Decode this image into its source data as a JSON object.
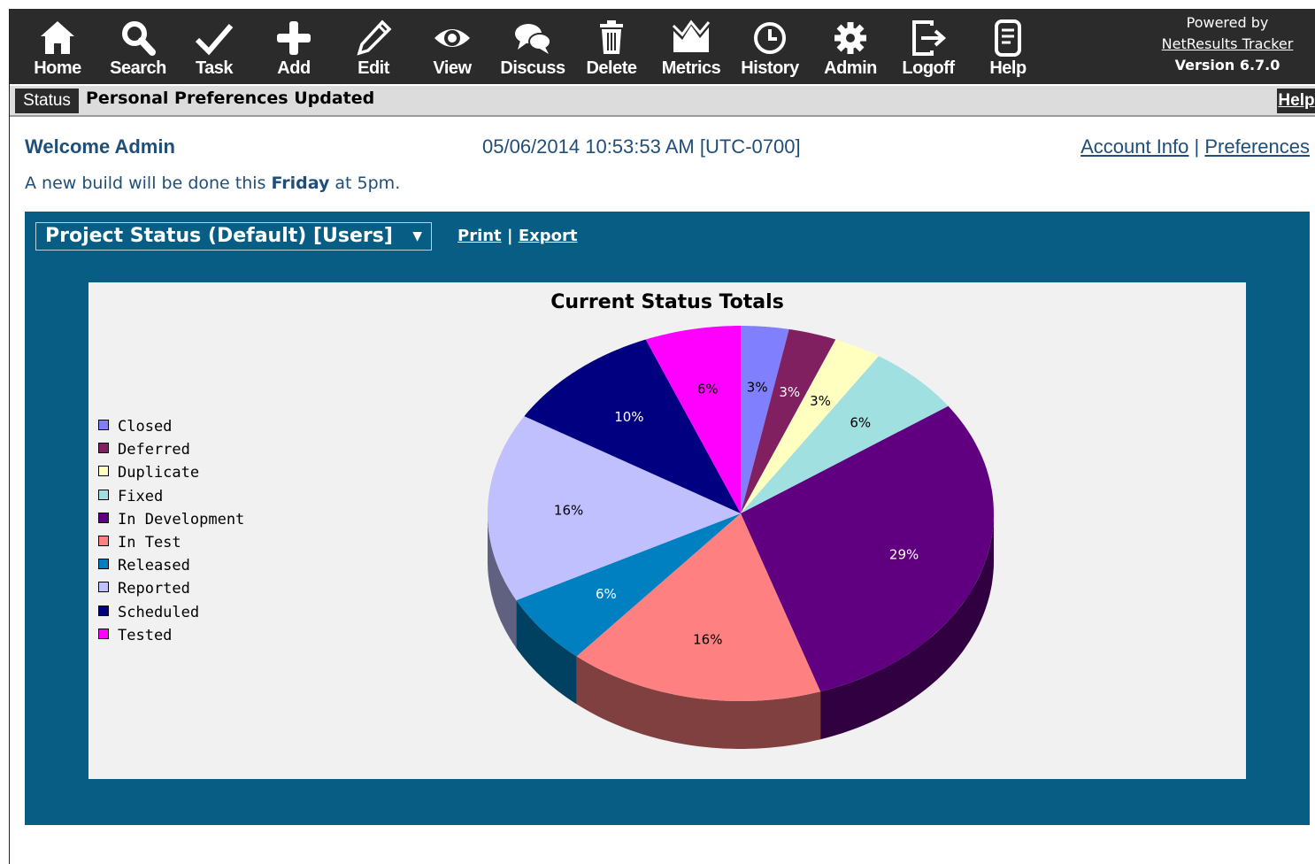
{
  "toolbar": {
    "items": [
      {
        "label": "Home",
        "icon": "home-icon"
      },
      {
        "label": "Search",
        "icon": "search-icon"
      },
      {
        "label": "Task",
        "icon": "checkmark-icon"
      },
      {
        "label": "Add",
        "icon": "plus-icon"
      },
      {
        "label": "Edit",
        "icon": "pencil-icon"
      },
      {
        "label": "View",
        "icon": "eye-icon"
      },
      {
        "label": "Discuss",
        "icon": "speech-bubbles-icon"
      },
      {
        "label": "Delete",
        "icon": "trash-icon"
      },
      {
        "label": "Metrics",
        "icon": "chart-icon"
      },
      {
        "label": "History",
        "icon": "clock-icon"
      },
      {
        "label": "Admin",
        "icon": "gear-icon"
      },
      {
        "label": "Logoff",
        "icon": "logout-icon"
      },
      {
        "label": "Help",
        "icon": "document-icon"
      }
    ],
    "powered_by": "Powered by",
    "product_link": "NetResults Tracker",
    "version": "Version 6.7.0"
  },
  "status": {
    "tag": "Status",
    "message": "Personal Preferences Updated",
    "help": "Help"
  },
  "welcome": {
    "greeting": "Welcome Admin",
    "datetime": "05/06/2014 10:53:53 AM [UTC-0700]",
    "account_info": "Account Info",
    "separator": "|",
    "preferences": "Preferences"
  },
  "notice": {
    "before": "A new build will be done this ",
    "bold": "Friday",
    "after": " at 5pm."
  },
  "panel": {
    "report_select": "Project Status (Default) [Users]",
    "print": "Print",
    "separator": "|",
    "export": "Export"
  },
  "chart_data": {
    "type": "pie",
    "title": "Current Status Totals",
    "categories": [
      "Closed",
      "Deferred",
      "Duplicate",
      "Fixed",
      "In Development",
      "In Test",
      "Released",
      "Reported",
      "Scheduled",
      "Tested"
    ],
    "values": [
      3,
      3,
      3,
      6,
      29,
      16,
      6,
      16,
      10,
      6
    ],
    "labels": [
      "3%",
      "3%",
      "3%",
      "6%",
      "29%",
      "16%",
      "6%",
      "16%",
      "10%",
      "6%"
    ],
    "colors": [
      "#8080ff",
      "#802060",
      "#ffffc0",
      "#a0e0e0",
      "#600080",
      "#ff8080",
      "#0080c0",
      "#c0c0ff",
      "#000080",
      "#ff00ff"
    ],
    "legend_position": "left"
  }
}
